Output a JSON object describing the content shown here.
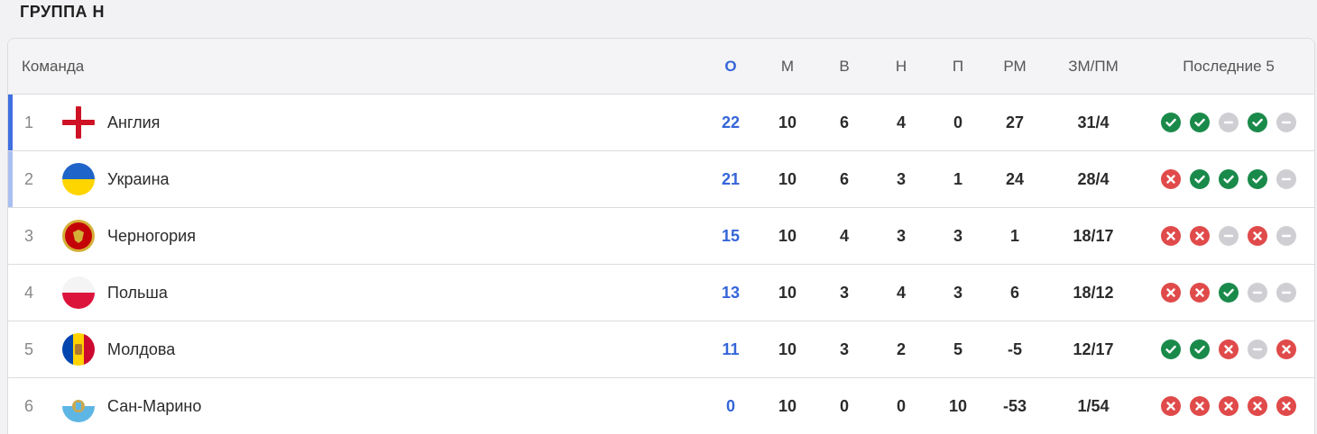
{
  "group_title": "ГРУППА H",
  "columns": {
    "team": "Команда",
    "points": "О",
    "played": "М",
    "won": "В",
    "drawn": "Н",
    "lost": "П",
    "goal_diff": "РМ",
    "goals": "ЗМ/ПМ",
    "last5": "Последние 5"
  },
  "colors": {
    "accent": "#3565d8",
    "qualify_1": "#3f6fe0",
    "qualify_2": "#a9bff2",
    "win": "#1a8a4a",
    "loss": "#e04a4a",
    "draw": "#cfcfd3"
  },
  "rows": [
    {
      "pos": "1",
      "team": "Англия",
      "flag": "england-flag-icon",
      "points": "22",
      "played": "10",
      "won": "6",
      "drawn": "4",
      "lost": "0",
      "goal_diff": "27",
      "goals": "31/4",
      "form": [
        "W",
        "W",
        "D",
        "W",
        "D"
      ],
      "marker": "qualify_1"
    },
    {
      "pos": "2",
      "team": "Украина",
      "flag": "ukraine-flag-icon",
      "points": "21",
      "played": "10",
      "won": "6",
      "drawn": "3",
      "lost": "1",
      "goal_diff": "24",
      "goals": "28/4",
      "form": [
        "L",
        "W",
        "W",
        "W",
        "D"
      ],
      "marker": "qualify_2"
    },
    {
      "pos": "3",
      "team": "Черногория",
      "flag": "montenegro-flag-icon",
      "points": "15",
      "played": "10",
      "won": "4",
      "drawn": "3",
      "lost": "3",
      "goal_diff": "1",
      "goals": "18/17",
      "form": [
        "L",
        "L",
        "D",
        "L",
        "D"
      ],
      "marker": ""
    },
    {
      "pos": "4",
      "team": "Польша",
      "flag": "poland-flag-icon",
      "points": "13",
      "played": "10",
      "won": "3",
      "drawn": "4",
      "lost": "3",
      "goal_diff": "6",
      "goals": "18/12",
      "form": [
        "L",
        "L",
        "W",
        "D",
        "D"
      ],
      "marker": ""
    },
    {
      "pos": "5",
      "team": "Молдова",
      "flag": "moldova-flag-icon",
      "points": "11",
      "played": "10",
      "won": "3",
      "drawn": "2",
      "lost": "5",
      "goal_diff": "-5",
      "goals": "12/17",
      "form": [
        "W",
        "W",
        "L",
        "D",
        "L"
      ],
      "marker": ""
    },
    {
      "pos": "6",
      "team": "Сан-Марино",
      "flag": "san-marino-flag-icon",
      "points": "0",
      "played": "10",
      "won": "0",
      "drawn": "0",
      "lost": "10",
      "goal_diff": "-53",
      "goals": "1/54",
      "form": [
        "L",
        "L",
        "L",
        "L",
        "L"
      ],
      "marker": ""
    }
  ]
}
